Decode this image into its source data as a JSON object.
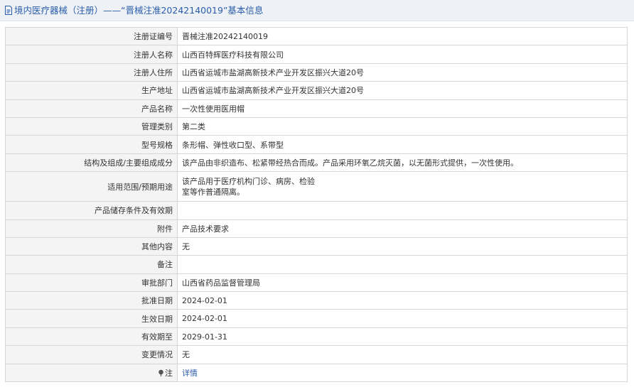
{
  "header": {
    "title": "境内医疗器械（注册）——“晋械注准20242140019”基本信息"
  },
  "rows": [
    {
      "label": "注册证编号",
      "value": "晋械注准20242140019"
    },
    {
      "label": "注册人名称",
      "value": "山西百特辉医疗科技有限公司"
    },
    {
      "label": "注册人住所",
      "value": "山西省运城市盐湖高新技术产业开发区振兴大道20号"
    },
    {
      "label": "生产地址",
      "value": "山西省运城市盐湖高新技术产业开发区振兴大道20号"
    },
    {
      "label": "产品名称",
      "value": "一次性使用医用帽"
    },
    {
      "label": "管理类别",
      "value": "第二类"
    },
    {
      "label": "型号规格",
      "value": "条形帽、弹性收口型、系带型"
    },
    {
      "label": "结构及组成/主要组成成分",
      "value": "该产品由非织造布、松紧带经热合而成。产品采用环氧乙烷灭菌，以无菌形式提供，一次性使用。"
    },
    {
      "label": "适用范围/预期用途",
      "value": "该产品用于医疗机构门诊、病房、检验室等作普通隔离。"
    },
    {
      "label": "产品储存条件及有效期",
      "value": ""
    },
    {
      "label": "附件",
      "value": "产品技术要求"
    },
    {
      "label": "其他内容",
      "value": "无"
    },
    {
      "label": "备注",
      "value": ""
    },
    {
      "label": "审批部门",
      "value": "山西省药品监督管理局"
    },
    {
      "label": "批准日期",
      "value": "2024-02-01"
    },
    {
      "label": "生效日期",
      "value": "2024-02-01"
    },
    {
      "label": "有效期至",
      "value": "2029-01-31"
    },
    {
      "label": "变更情况",
      "value": "无"
    }
  ],
  "note": {
    "label": "注",
    "link": "详情"
  },
  "colors": {
    "header_bg": "#eef2f7",
    "link": "#2a5caa",
    "label_bg": "#f4f4f4",
    "border": "#d6d6d6"
  }
}
